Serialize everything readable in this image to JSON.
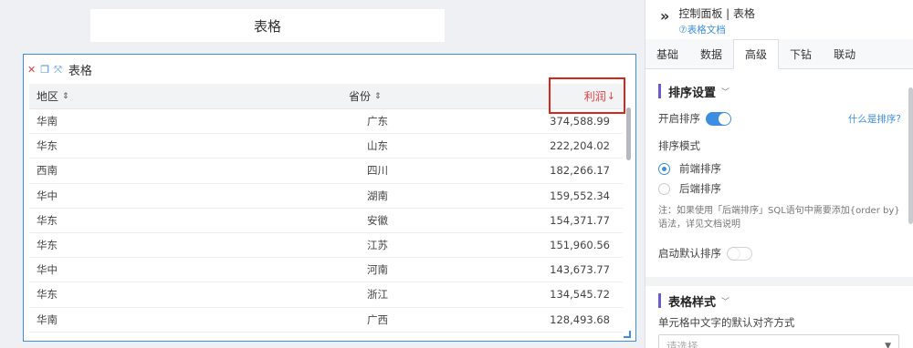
{
  "canvas": {
    "title_card": "表格",
    "widget": {
      "title": "表格",
      "icons": [
        "close-icon",
        "copy-icon",
        "expand-icon"
      ],
      "table": {
        "headers": [
          "地区",
          "省份",
          "利润"
        ],
        "header_sort_icons": [
          "⇕",
          "⇕",
          "↓"
        ],
        "rows": [
          [
            "华南",
            "广东",
            "374,588.99"
          ],
          [
            "华东",
            "山东",
            "222,204.02"
          ],
          [
            "西南",
            "四川",
            "182,266.17"
          ],
          [
            "华中",
            "湖南",
            "159,552.34"
          ],
          [
            "华东",
            "安徽",
            "154,371.77"
          ],
          [
            "华东",
            "江苏",
            "151,960.56"
          ],
          [
            "华中",
            "河南",
            "143,673.77"
          ],
          [
            "华东",
            "浙江",
            "134,545.72"
          ],
          [
            "华南",
            "广西",
            "128,493.68"
          ]
        ]
      }
    }
  },
  "panel": {
    "title": "控制面板 | 表格",
    "doc_link": "⑦表格文档",
    "tabs": [
      "基础",
      "数据",
      "高级",
      "下钻",
      "联动"
    ],
    "active_tab": "高级",
    "sort_section": {
      "title": "排序设置",
      "enable_label": "开启排序",
      "enable_on": true,
      "help_link": "什么是排序?",
      "mode_label": "排序模式",
      "options": [
        "前端排序",
        "后端排序"
      ],
      "selected_option": "前端排序",
      "note": "注：如果使用「后端排序」SQL语句中需要添加{order by}语法，详见文档说明",
      "default_sort_label": "启动默认排序",
      "default_sort_on": false
    },
    "style_section": {
      "title": "表格样式",
      "align_label": "单元格中文字的默认对齐方式",
      "align_placeholder": "请选择"
    }
  },
  "colors": {
    "accent": "#3d8de0",
    "sort_active": "#e04040",
    "section_bar": "#6b5bd2"
  }
}
